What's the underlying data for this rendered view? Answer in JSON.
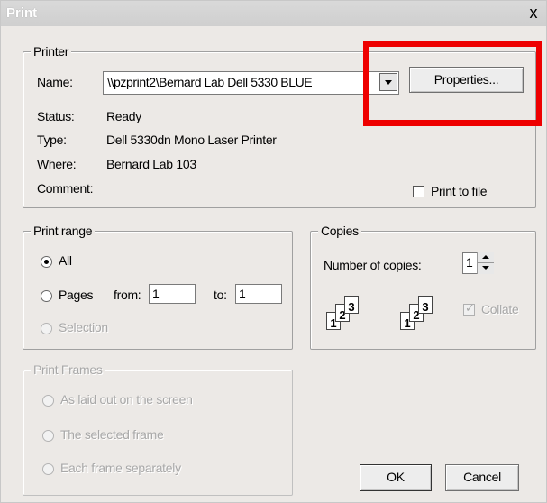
{
  "window": {
    "title": "Print",
    "close_glyph": "x"
  },
  "printer": {
    "legend": "Printer",
    "name_label": "Name:",
    "name_value": "\\\\pzprint2\\Bernard Lab Dell 5330 BLUE",
    "properties_label": "Properties...",
    "status_label": "Status:",
    "status_value": "Ready",
    "type_label": "Type:",
    "type_value": "Dell 5330dn Mono Laser Printer",
    "where_label": "Where:",
    "where_value": "Bernard Lab 103",
    "comment_label": "Comment:",
    "print_to_file_label": "Print to file"
  },
  "print_range": {
    "legend": "Print range",
    "all_label": "All",
    "pages_label": "Pages",
    "from_label": "from:",
    "from_value": "1",
    "to_label": "to:",
    "to_value": "1",
    "selection_label": "Selection"
  },
  "copies": {
    "legend": "Copies",
    "number_label": "Number of copies:",
    "number_value": "1",
    "collate_label": "Collate",
    "collate_icon_pages": [
      "1",
      "2",
      "3"
    ]
  },
  "print_frames": {
    "legend": "Print Frames",
    "option1": "As laid out on the screen",
    "option2": "The selected frame",
    "option3": "Each frame separately"
  },
  "buttons": {
    "ok": "OK",
    "cancel": "Cancel"
  },
  "colors": {
    "highlight": "#ee0000",
    "dialog_bg": "#ece9e6"
  }
}
